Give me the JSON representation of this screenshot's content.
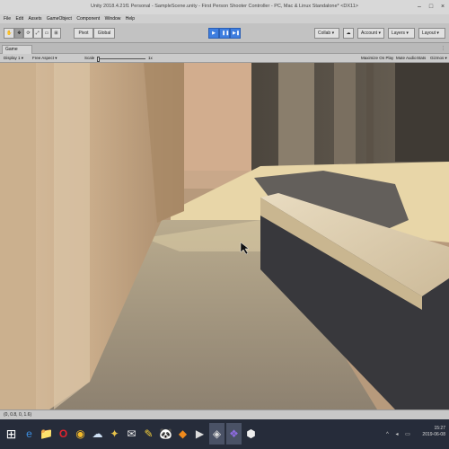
{
  "window": {
    "title": "Unity 2018.4.21f1 Personal - SampleScene.unity - First Person Shooter Controller - PC, Mac & Linux Standalone* <DX11>"
  },
  "menu": [
    "File",
    "Edit",
    "Assets",
    "GameObject",
    "Component",
    "Window",
    "Help"
  ],
  "toolbar": {
    "tools": [
      "✋",
      "✥",
      "⟳",
      "⤢",
      "▭",
      "⊞"
    ],
    "pivot_label": "Pivot",
    "global_label": "Global",
    "play_icons": [
      "▶",
      "❚❚",
      "▶❚"
    ],
    "collab_label": "Collab ▾",
    "cloud_icon": "☁",
    "account_label": "Account ▾",
    "layers_label": "Layers ▾",
    "layout_label": "Layout ▾"
  },
  "game_view": {
    "tab_label": "Game",
    "display_label": "Display 1 ▾",
    "aspect_label": "Free Aspect ▾",
    "scale_label": "Scale",
    "scale_value": "1x",
    "maximize_label": "Maximize On Play",
    "mute_label": "Mute Audio",
    "stats_label": "Stats",
    "gizmos_label": "Gizmos ▾",
    "menu_dots": "⋮"
  },
  "status": {
    "text": "(0, 0.8, 0, 1.6)"
  },
  "taskbar": {
    "start_icon": "⊞",
    "apps": [
      "e",
      "📁",
      "O",
      "◉",
      "☁",
      "✦",
      "✉",
      "✎",
      "🐼",
      "◆",
      "▶",
      "◈",
      "❖",
      "⬢"
    ],
    "time": "15:27",
    "date": "2019-06-08",
    "tray": "^ ◂ ▭"
  },
  "colors": {
    "play_blue": "#3e7ee0",
    "taskbar": "#262c3a",
    "sand": "#e8d6a8"
  }
}
